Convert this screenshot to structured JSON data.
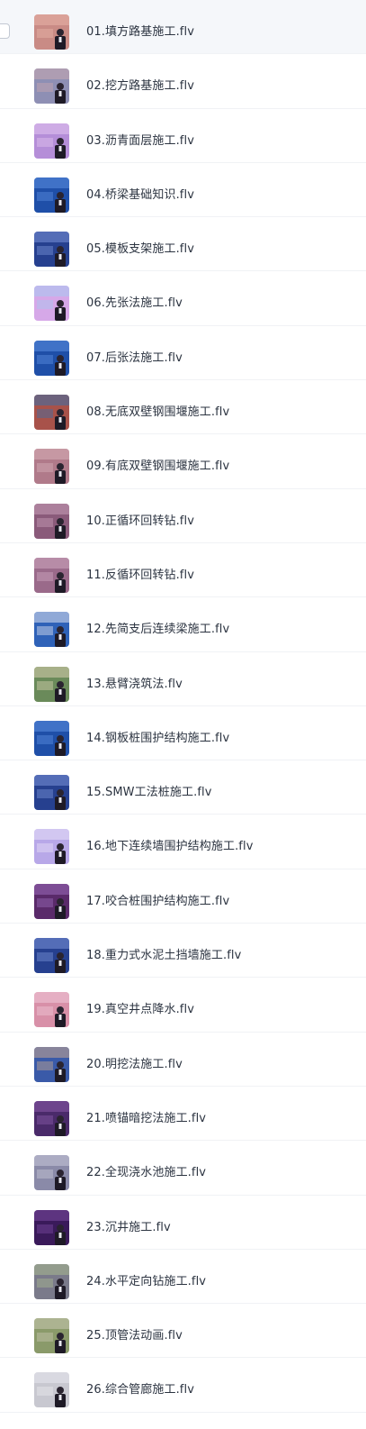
{
  "files": [
    {
      "name": "01.填方路基施工.flv",
      "thumb_bg": "#c98b85",
      "thumb_accent": "#e8b5a8",
      "icon": "video-thumbnail-icon"
    },
    {
      "name": "02.挖方路基施工.flv",
      "thumb_bg": "#8e8fb4",
      "thumb_accent": "#c9a9b0",
      "icon": "video-thumbnail-icon"
    },
    {
      "name": "03.沥青面层施工.flv",
      "thumb_bg": "#b58ed8",
      "thumb_accent": "#e2c4f0",
      "icon": "video-thumbnail-icon"
    },
    {
      "name": "04.桥梁基础知识.flv",
      "thumb_bg": "#1f4fa8",
      "thumb_accent": "#5b8fe0",
      "icon": "video-thumbnail-icon"
    },
    {
      "name": "05.模板支架施工.flv",
      "thumb_bg": "#26408f",
      "thumb_accent": "#7a92d8",
      "icon": "video-thumbnail-icon"
    },
    {
      "name": "06.先张法施工.flv",
      "thumb_bg": "#d6a8e8",
      "thumb_accent": "#a8c8f0",
      "icon": "video-thumbnail-icon"
    },
    {
      "name": "07.后张法施工.flv",
      "thumb_bg": "#1f4fa8",
      "thumb_accent": "#5b8fe0",
      "icon": "video-thumbnail-icon"
    },
    {
      "name": "08.无底双壁钢围堰施工.flv",
      "thumb_bg": "#a8524a",
      "thumb_accent": "#3b6fa8",
      "icon": "video-thumbnail-icon"
    },
    {
      "name": "09.有底双壁钢围堰施工.flv",
      "thumb_bg": "#b07a8a",
      "thumb_accent": "#d8b0b8",
      "icon": "video-thumbnail-icon"
    },
    {
      "name": "10.正循环回转钻.flv",
      "thumb_bg": "#8a5a7a",
      "thumb_accent": "#c8a0b8",
      "icon": "video-thumbnail-icon"
    },
    {
      "name": "11.反循环回转钻.flv",
      "thumb_bg": "#9a6a8a",
      "thumb_accent": "#d0a8c0",
      "icon": "video-thumbnail-icon"
    },
    {
      "name": "12.先简支后连续梁施工.flv",
      "thumb_bg": "#2f62b8",
      "thumb_accent": "#e0e4f0",
      "icon": "video-thumbnail-icon"
    },
    {
      "name": "13.悬臂浇筑法.flv",
      "thumb_bg": "#6a8a5a",
      "thumb_accent": "#d8d0b0",
      "icon": "video-thumbnail-icon"
    },
    {
      "name": "14.钢板桩围护结构施工.flv",
      "thumb_bg": "#1f4fa8",
      "thumb_accent": "#5b8fe0",
      "icon": "video-thumbnail-icon"
    },
    {
      "name": "15.SMW工法桩施工.flv",
      "thumb_bg": "#26408f",
      "thumb_accent": "#7a92d8",
      "icon": "video-thumbnail-icon"
    },
    {
      "name": "16.地下连续墙围护结构施工.flv",
      "thumb_bg": "#b8a8e8",
      "thumb_accent": "#e8e0f8",
      "icon": "video-thumbnail-icon"
    },
    {
      "name": "17.咬合桩围护结构施工.flv",
      "thumb_bg": "#5a2a6a",
      "thumb_accent": "#9a6ab8",
      "icon": "video-thumbnail-icon"
    },
    {
      "name": "18.重力式水泥土挡墙施工.flv",
      "thumb_bg": "#26408f",
      "thumb_accent": "#7a92d8",
      "icon": "video-thumbnail-icon"
    },
    {
      "name": "19.真空井点降水.flv",
      "thumb_bg": "#d890a8",
      "thumb_accent": "#f0c8d8",
      "icon": "video-thumbnail-icon"
    },
    {
      "name": "20.明挖法施工.flv",
      "thumb_bg": "#3a5aa8",
      "thumb_accent": "#c8a890",
      "icon": "video-thumbnail-icon"
    },
    {
      "name": "21.喷锚暗挖法施工.flv",
      "thumb_bg": "#4a2a6a",
      "thumb_accent": "#8a5aa8",
      "icon": "video-thumbnail-icon"
    },
    {
      "name": "22.全现浇水池施工.flv",
      "thumb_bg": "#8a8aa8",
      "thumb_accent": "#c8c8d8",
      "icon": "video-thumbnail-icon"
    },
    {
      "name": "23.沉井施工.flv",
      "thumb_bg": "#3a1a5a",
      "thumb_accent": "#7a4aa0",
      "icon": "video-thumbnail-icon"
    },
    {
      "name": "24.水平定向钻施工.flv",
      "thumb_bg": "#7a7a8a",
      "thumb_accent": "#a8b890",
      "icon": "video-thumbnail-icon"
    },
    {
      "name": "25.顶管法动画.flv",
      "thumb_bg": "#8a9a6a",
      "thumb_accent": "#c8c8b0",
      "icon": "video-thumbnail-icon"
    },
    {
      "name": "26.综合管廊施工.flv",
      "thumb_bg": "#c8c8d0",
      "thumb_accent": "#e8e8ee",
      "icon": "video-thumbnail-icon"
    }
  ]
}
